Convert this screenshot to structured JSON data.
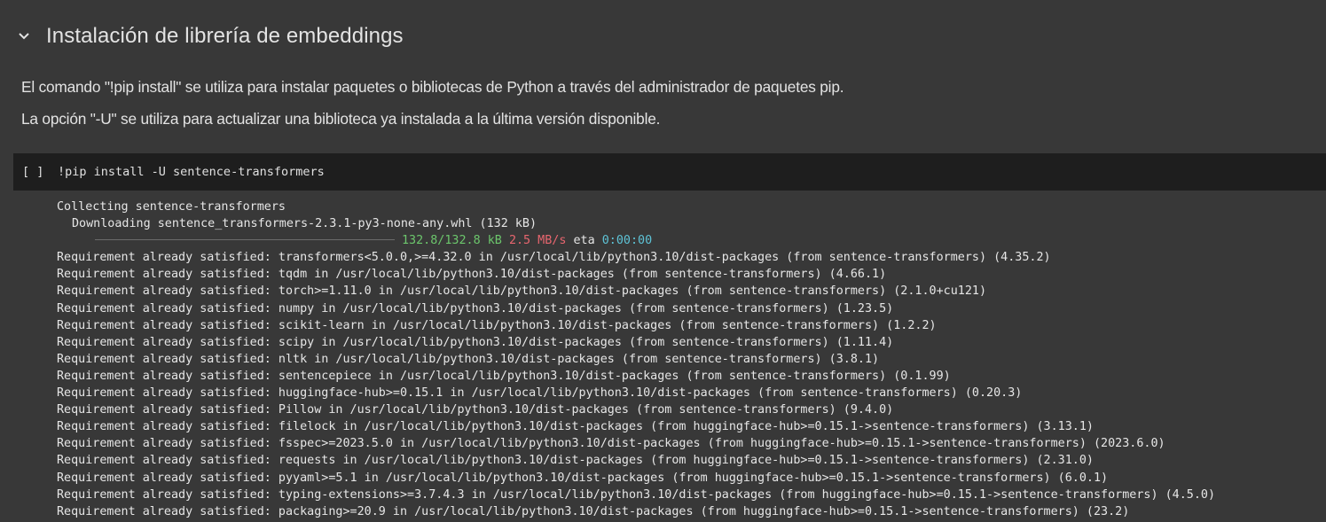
{
  "section": {
    "title": "Instalación de librería de embeddings",
    "chevron_icon": "chevron-down-icon"
  },
  "markdown": {
    "para1": "El comando \"!pip install\" se utiliza para instalar paquetes o bibliotecas de Python a través del administrador de paquetes pip.",
    "para2": "La opción \"-U\" se utiliza para actualizar una biblioteca ya instalada a la última versión disponible."
  },
  "code_cell": {
    "run_indicator": "[ ]",
    "code": "!pip install -U sentence-transformers"
  },
  "output": {
    "collecting": "Collecting sentence-transformers",
    "downloading": "Downloading sentence_transformers-2.3.1-py3-none-any.whl (132 kB)",
    "progress": {
      "fraction": 1.0,
      "size": "132.8/132.8 kB",
      "speed": "2.5 MB/s",
      "eta_label": "eta",
      "eta": "0:00:00"
    },
    "requirements": [
      "Requirement already satisfied: transformers<5.0.0,>=4.32.0 in /usr/local/lib/python3.10/dist-packages (from sentence-transformers) (4.35.2)",
      "Requirement already satisfied: tqdm in /usr/local/lib/python3.10/dist-packages (from sentence-transformers) (4.66.1)",
      "Requirement already satisfied: torch>=1.11.0 in /usr/local/lib/python3.10/dist-packages (from sentence-transformers) (2.1.0+cu121)",
      "Requirement already satisfied: numpy in /usr/local/lib/python3.10/dist-packages (from sentence-transformers) (1.23.5)",
      "Requirement already satisfied: scikit-learn in /usr/local/lib/python3.10/dist-packages (from sentence-transformers) (1.2.2)",
      "Requirement already satisfied: scipy in /usr/local/lib/python3.10/dist-packages (from sentence-transformers) (1.11.4)",
      "Requirement already satisfied: nltk in /usr/local/lib/python3.10/dist-packages (from sentence-transformers) (3.8.1)",
      "Requirement already satisfied: sentencepiece in /usr/local/lib/python3.10/dist-packages (from sentence-transformers) (0.1.99)",
      "Requirement already satisfied: huggingface-hub>=0.15.1 in /usr/local/lib/python3.10/dist-packages (from sentence-transformers) (0.20.3)",
      "Requirement already satisfied: Pillow in /usr/local/lib/python3.10/dist-packages (from sentence-transformers) (9.4.0)",
      "Requirement already satisfied: filelock in /usr/local/lib/python3.10/dist-packages (from huggingface-hub>=0.15.1->sentence-transformers) (3.13.1)",
      "Requirement already satisfied: fsspec>=2023.5.0 in /usr/local/lib/python3.10/dist-packages (from huggingface-hub>=0.15.1->sentence-transformers) (2023.6.0)",
      "Requirement already satisfied: requests in /usr/local/lib/python3.10/dist-packages (from huggingface-hub>=0.15.1->sentence-transformers) (2.31.0)",
      "Requirement already satisfied: pyyaml>=5.1 in /usr/local/lib/python3.10/dist-packages (from huggingface-hub>=0.15.1->sentence-transformers) (6.0.1)",
      "Requirement already satisfied: typing-extensions>=3.7.4.3 in /usr/local/lib/python3.10/dist-packages (from huggingface-hub>=0.15.1->sentence-transformers) (4.5.0)",
      "Requirement already satisfied: packaging>=20.9 in /usr/local/lib/python3.10/dist-packages (from huggingface-hub>=0.15.1->sentence-transformers) (23.2)"
    ]
  },
  "colors": {
    "background": "#383838",
    "cell_background": "#1e1e1e",
    "text": "#e3e3e3",
    "progress_size": "#6cc66c",
    "progress_speed": "#e8666f",
    "progress_eta": "#5ec3d6"
  }
}
